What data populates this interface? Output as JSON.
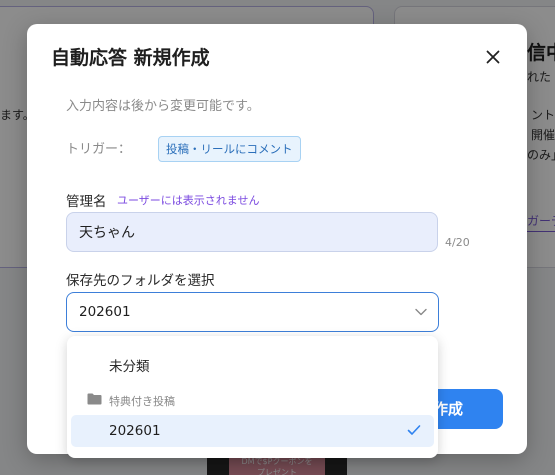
{
  "background": {
    "left_text": "ます。",
    "right_heading": "信中",
    "right_lines": [
      "れた",
      "ント",
      "開催",
      "のみ」"
    ],
    "right_link": "ガーデ",
    "phone_banner": [
      "DMで$Pクーポンを",
      "プレゼント"
    ]
  },
  "modal": {
    "title": "自動応答 新規作成",
    "note": "入力内容は後から変更可能です。",
    "trigger_label": "トリガー：",
    "trigger_value": "投稿・リールにコメント",
    "name_label": "管理名",
    "name_hint": "ユーザーには表示されません",
    "name_value": "天ちゃん",
    "name_count": "4/20",
    "folder_label": "保存先のフォルダを選択",
    "folder_value": "202601",
    "create_label": "作成"
  },
  "dropdown": {
    "items": [
      {
        "label": "未分類",
        "type": "option"
      },
      {
        "label": "特典付き投稿",
        "type": "group",
        "icon": "folder-icon"
      },
      {
        "label": "202601",
        "type": "option",
        "selected": true,
        "icon": "check-icon"
      }
    ]
  },
  "colors": {
    "accent": "#2f83f0",
    "hint": "#7b4ae0",
    "badge_bg": "#e8f3fd",
    "badge_text": "#2b6fba",
    "input_bg": "#e9eefc"
  }
}
